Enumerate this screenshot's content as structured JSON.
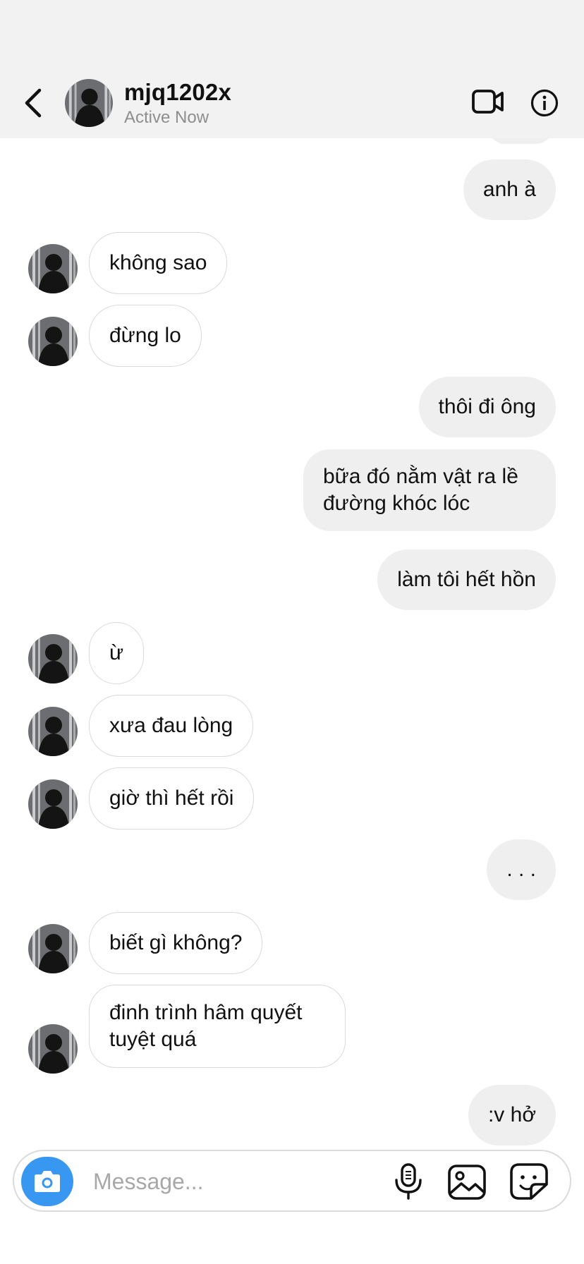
{
  "header": {
    "username": "mjq1202x",
    "status": "Active Now",
    "back_icon": "chevron-left-icon",
    "video_icon": "video-call-icon",
    "info_icon": "info-icon"
  },
  "messages": [
    {
      "side": "out",
      "text": "anh à"
    },
    {
      "side": "in",
      "text": "không sao"
    },
    {
      "side": "in",
      "text": "đừng lo"
    },
    {
      "side": "out",
      "text": "thôi đi ông"
    },
    {
      "side": "out",
      "text": "bữa đó nằm vật ra lề đường khóc lóc"
    },
    {
      "side": "out",
      "text": "làm tôi hết hồn"
    },
    {
      "side": "in",
      "text": "ừ"
    },
    {
      "side": "in",
      "text": "xưa đau lòng"
    },
    {
      "side": "in",
      "text": "giờ thì hết rồi"
    },
    {
      "side": "out",
      "text": ". . ."
    },
    {
      "side": "in",
      "text": "biết gì không?"
    },
    {
      "side": "in",
      "text": "đinh trình hâm quyết tuyệt quá"
    },
    {
      "side": "out",
      "text": ":v hở"
    }
  ],
  "composer": {
    "placeholder": "Message...",
    "value": "",
    "camera_icon": "camera-icon",
    "mic_icon": "microphone-icon",
    "gallery_icon": "image-gallery-icon",
    "sticker_icon": "sticker-icon"
  },
  "colors": {
    "header_bg": "#f2f2f3",
    "outgoing_bubble": "#efefef",
    "incoming_border": "#d9d9d9",
    "accent": "#3897f0"
  }
}
